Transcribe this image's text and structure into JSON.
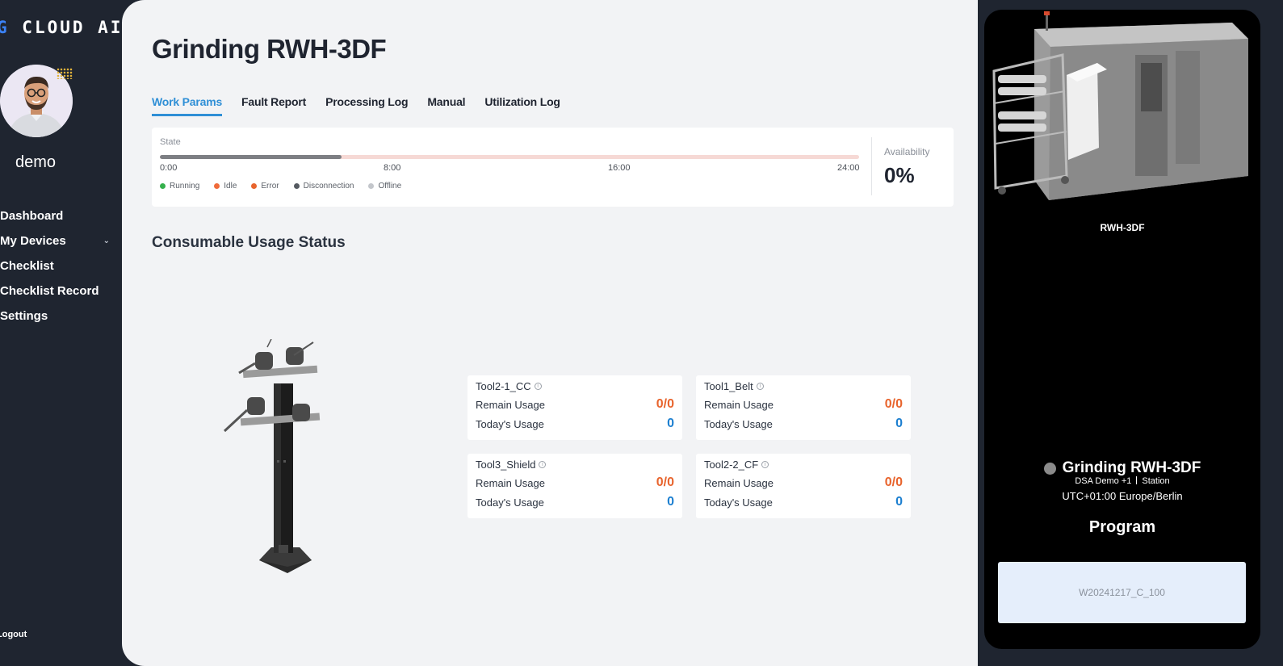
{
  "brand": {
    "mark": "G",
    "text": " CLOUD AI"
  },
  "user": {
    "name": "demo"
  },
  "nav": {
    "dashboard": "Dashboard",
    "my_devices": "My Devices",
    "checklist": "Checklist",
    "checklist_record": "Checklist Record",
    "settings": "Settings",
    "logout": "Logout"
  },
  "page": {
    "title": "Grinding RWH-3DF"
  },
  "tabs": [
    "Work Params",
    "Fault Report",
    "Processing Log",
    "Manual",
    "Utilization Log"
  ],
  "state": {
    "label": "State",
    "ticks": [
      "0:00",
      "8:00",
      "16:00",
      "24:00"
    ],
    "recorded_fraction": 0.26,
    "legend": [
      {
        "label": "Running",
        "color": "#35b04c"
      },
      {
        "label": "Idle",
        "color": "#f06b3a"
      },
      {
        "label": "Error",
        "color": "#e8642d"
      },
      {
        "label": "Disconnection",
        "color": "#555a61"
      },
      {
        "label": "Offline",
        "color": "#c3c6cb"
      }
    ],
    "availability_label": "Availability",
    "availability_value": "0%"
  },
  "consumables": {
    "title": "Consumable Usage Status",
    "remain_label": "Remain Usage",
    "today_label": "Today's Usage",
    "tools": [
      {
        "name": "Tool2-1_CC",
        "remain": "0/0",
        "today": "0"
      },
      {
        "name": "Tool1_Belt",
        "remain": "0/0",
        "today": "0"
      },
      {
        "name": "Tool3_Shield",
        "remain": "0/0",
        "today": "0"
      },
      {
        "name": "Tool2-2_CF",
        "remain": "0/0",
        "today": "0"
      }
    ]
  },
  "device": {
    "caption": "RWH-3DF",
    "name": "Grinding RWH-3DF",
    "group": "DSA Demo +1",
    "type": "Station",
    "timezone": "UTC+01:00 Europe/Berlin",
    "status_color": "#8b8b8b",
    "program_label": "Program",
    "program_value": "W20241217_C_100"
  }
}
